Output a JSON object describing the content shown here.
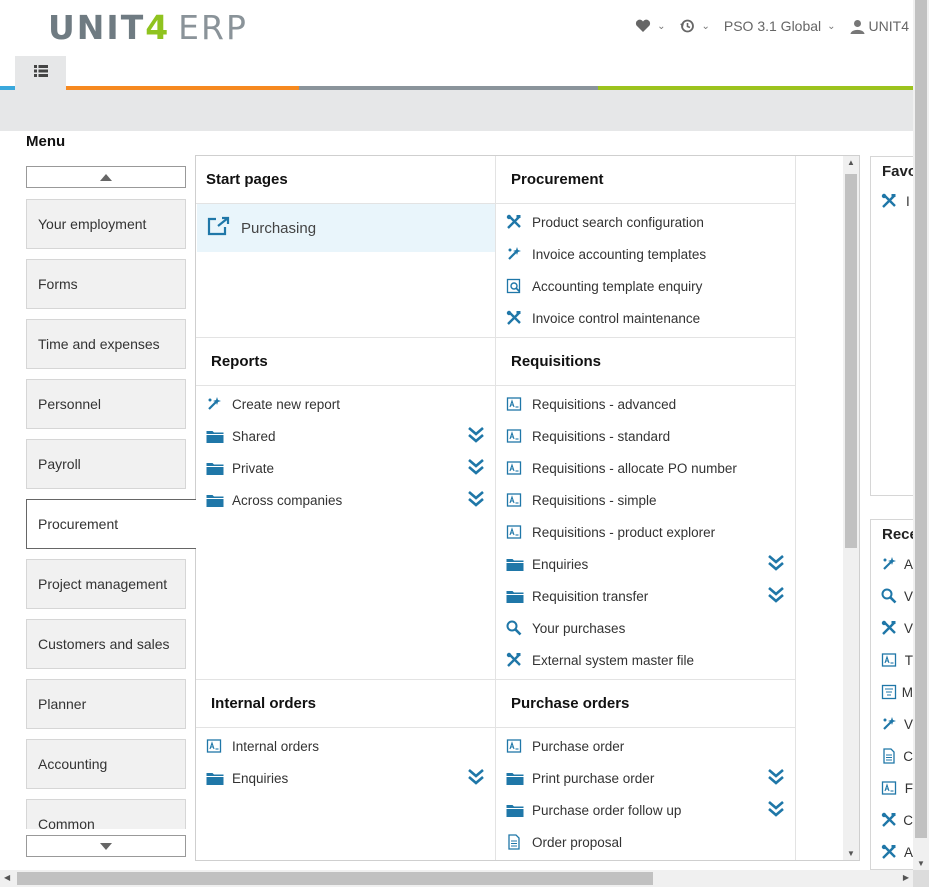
{
  "brand": {
    "word": "UNIT",
    "digit": "4",
    "product": "ERP"
  },
  "header": {
    "favourites_icon": "heart-icon",
    "history_icon": "history-icon",
    "company": "PSO 3.1 Global",
    "user": "UNIT4"
  },
  "colors": {
    "orange": "#f6891f",
    "gray": "#8a949b",
    "green": "#9cc31e",
    "blue": "#3aa8dc",
    "icon_blue": "#1f77a8"
  },
  "menu": {
    "title": "Menu",
    "items": [
      "Your employment",
      "Forms",
      "Time and expenses",
      "Personnel",
      "Payroll",
      "Procurement",
      "Project management",
      "Customers and sales",
      "Planner",
      "Accounting",
      "Common"
    ],
    "active": "Procurement"
  },
  "sections": {
    "start_pages": {
      "title": "Start pages",
      "items": [
        {
          "label": "Purchasing",
          "icon": "open-external-icon"
        }
      ]
    },
    "procurement": {
      "title": "Procurement",
      "items": [
        {
          "label": "Product search configuration",
          "icon": "tools-icon"
        },
        {
          "label": "Invoice accounting templates",
          "icon": "magic-wand-icon"
        },
        {
          "label": "Accounting template enquiry",
          "icon": "enquiry-icon"
        },
        {
          "label": "Invoice control maintenance",
          "icon": "tools-icon"
        }
      ]
    },
    "reports": {
      "title": "Reports",
      "items": [
        {
          "label": "Create new report",
          "icon": "magic-wand-icon"
        },
        {
          "label": "Shared",
          "icon": "folder-icon"
        },
        {
          "label": "Private",
          "icon": "folder-icon"
        },
        {
          "label": "Across companies",
          "icon": "folder-icon"
        }
      ]
    },
    "requisitions": {
      "title": "Requisitions",
      "items": [
        {
          "label": "Requisitions - advanced",
          "icon": "form-icon"
        },
        {
          "label": "Requisitions - standard",
          "icon": "form-icon"
        },
        {
          "label": "Requisitions - allocate PO number",
          "icon": "form-icon"
        },
        {
          "label": "Requisitions - simple",
          "icon": "form-icon"
        },
        {
          "label": "Requisitions - product explorer",
          "icon": "form-icon"
        },
        {
          "label": "Enquiries",
          "icon": "folder-icon"
        },
        {
          "label": "Requisition transfer",
          "icon": "folder-icon"
        },
        {
          "label": "Your purchases",
          "icon": "search-icon"
        },
        {
          "label": "External system master file",
          "icon": "tools-icon"
        }
      ]
    },
    "internal_orders": {
      "title": "Internal orders",
      "items": [
        {
          "label": "Internal orders",
          "icon": "form-icon"
        },
        {
          "label": "Enquiries",
          "icon": "folder-icon"
        }
      ]
    },
    "purchase_orders": {
      "title": "Purchase orders",
      "items": [
        {
          "label": "Purchase order",
          "icon": "form-icon"
        },
        {
          "label": "Print purchase order",
          "icon": "folder-icon"
        },
        {
          "label": "Purchase order follow up",
          "icon": "folder-icon"
        },
        {
          "label": "Order proposal",
          "icon": "document-icon"
        }
      ]
    }
  },
  "right": {
    "favourites": {
      "title": "Favo",
      "items": [
        "I"
      ]
    },
    "recent": {
      "title": "Rece",
      "items": [
        "A",
        "V",
        "V",
        "T",
        "M",
        "V",
        "C",
        "F",
        "C",
        "A"
      ]
    }
  }
}
